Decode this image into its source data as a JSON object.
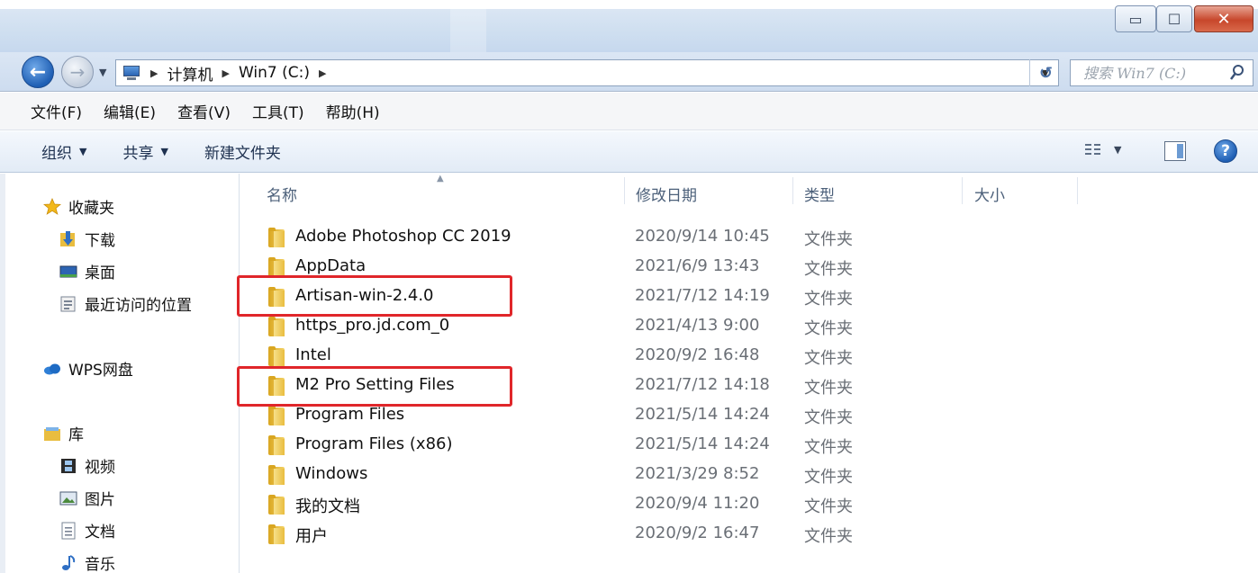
{
  "window": {
    "controls": {
      "minimize": "▭",
      "maximize": "☐",
      "close": "✕"
    }
  },
  "address_bar": {
    "breadcrumbs": [
      "计算机",
      "Win7 (C:)"
    ],
    "search_placeholder": "搜索 Win7 (C:)"
  },
  "menu": [
    "文件(F)",
    "编辑(E)",
    "查看(V)",
    "工具(T)",
    "帮助(H)"
  ],
  "toolbar": {
    "organize": "组织",
    "share": "共享",
    "new_folder": "新建文件夹"
  },
  "nav_pane": {
    "favorites": "收藏夹",
    "downloads": "下载",
    "desktop": "桌面",
    "recent": "最近访问的位置",
    "wps": "WPS网盘",
    "libraries": "库",
    "videos": "视频",
    "pictures": "图片",
    "documents": "文档",
    "music": "音乐"
  },
  "columns": {
    "name": "名称",
    "date": "修改日期",
    "type": "类型",
    "size": "大小"
  },
  "files": [
    {
      "name": "Adobe Photoshop CC 2019",
      "date": "2020/9/14 10:45",
      "type": "文件夹"
    },
    {
      "name": "AppData",
      "date": "2021/6/9 13:43",
      "type": "文件夹"
    },
    {
      "name": "Artisan-win-2.4.0",
      "date": "2021/7/12 14:19",
      "type": "文件夹",
      "highlighted": true
    },
    {
      "name": "https_pro.jd.com_0",
      "date": "2021/4/13 9:00",
      "type": "文件夹"
    },
    {
      "name": "Intel",
      "date": "2020/9/2 16:48",
      "type": "文件夹"
    },
    {
      "name": "M2 Pro Setting Files",
      "date": "2021/7/12 14:18",
      "type": "文件夹",
      "highlighted": true
    },
    {
      "name": "Program Files",
      "date": "2021/5/14 14:24",
      "type": "文件夹"
    },
    {
      "name": "Program Files (x86)",
      "date": "2021/5/14 14:24",
      "type": "文件夹"
    },
    {
      "name": "Windows",
      "date": "2021/3/29 8:52",
      "type": "文件夹"
    },
    {
      "name": "我的文档",
      "date": "2020/9/4 11:20",
      "type": "文件夹"
    },
    {
      "name": "用户",
      "date": "2020/9/2 16:47",
      "type": "文件夹"
    }
  ],
  "colors": {
    "highlight": "#e0262a",
    "folder": "#e9bd3f",
    "accent": "#1f5fb4"
  }
}
